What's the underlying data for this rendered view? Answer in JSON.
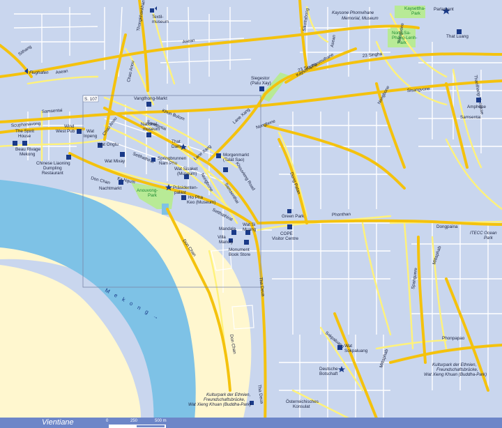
{
  "colors": {
    "land": "#c9d6ee",
    "water": "#7ec2e6",
    "sand": "#fff7cf",
    "park": "#b8ea96",
    "major_road": "#f4c20d",
    "minor_road": "#fff27a",
    "street": "#ffffff",
    "bar": "#6d86c8"
  },
  "footer": {
    "city": "Vientiane",
    "scale_0": "0",
    "scale_250": "250",
    "scale_500": "500 m"
  },
  "inset_label": "S. 107",
  "river_label": "M e k o n g →",
  "roads": {
    "samsentai_w": "Samsentai",
    "samsentai_c": "Samsentai",
    "samsentai_e": "Samsentai",
    "souphanavong": "Souphanavong",
    "asean_n": "Asean",
    "asean_w": "Asean",
    "sithang": "Sithang",
    "chao_anou_n": "Chao Anou",
    "chao_anou_s": "Chao Anou",
    "thongkhankham": "Thongkhankham",
    "khun_bulom": "Khun Bulom",
    "lane_xang": "Lane Xang",
    "lane_xang_s": "Lane Xang",
    "setthathirat": "Setthathirat",
    "setthathirat_s": "Setthathirat",
    "fa_ngum": "Fa Ngum",
    "don_chan_w": "Don Chan",
    "don_chan_c": "Don Chan",
    "don_chan_s": "Don Chan",
    "nongbone": "Nongbone",
    "nongbone_s": "Nongbone",
    "khouvieng": "Khouvieng Road",
    "dong_palan": "Dong Palan",
    "phonthan": "Phonthan",
    "dongpaina": "Dongpaina",
    "sisangvone": "Sisangvone",
    "kaysone": "Kaysone Phomvihane",
    "ring23": "23 Singha",
    "singha23": "23 Singha",
    "nongbone_ne": "Nongbone",
    "thatluang": "Thanthang-Hongkae",
    "sikottabong": "Sikottabong",
    "asean_e": "Asean",
    "nongbone_n": "Nongbone",
    "tha_deua": "Tha Deua",
    "tha_deua_s": "Tha Deua",
    "sokpaluang": "Sokpaluang",
    "phonpapao": "Phonpapao",
    "mittaphab": "Mittaphab",
    "mittaphab_s": "Mittaphab",
    "spanguere": "Spanguere",
    "samsenthai_khou": "Samsenthai"
  },
  "places": {
    "flughafen": "Flughafen",
    "textil1": "Textil-",
    "textil2": "museum",
    "kaysone_mem1": "Kaysone Phomvihane",
    "kaysone_mem2": "Memorial, Museum",
    "kaysettha1": "Kaysettha-",
    "kaysettha2": "Park",
    "parlament": "Parlament",
    "nongsa1": "Nong-Sa-",
    "nongsa2": "Phang-Lenh-",
    "nongsa3": "Park",
    "that_luang": "That Luang",
    "siegestor1": "Siegestor",
    "siegestor2": "(Patu Xay)",
    "amphone": "Amphone",
    "vangthong": "Vangthong-Markt",
    "national1": "National-",
    "national2": "museum",
    "spirit1": "The Spirit",
    "spirit2": "House",
    "beau1": "Beau Rivage",
    "beau2": "Mekong",
    "wind1": "Wind",
    "wind2": "West Pub",
    "watinpeng1": "Wat",
    "watinpeng2": "Inpeng",
    "ongtu": "Wat Ongtu",
    "mixay": "Wat Mixay",
    "thatdam1": "That",
    "thatdam2": "Dam",
    "springbrunnen1": "Springbrunnen",
    "springbrunnen2": "Nam Phu",
    "watsisaket1": "Wat Sisaket",
    "watsisaket2": "(Museum)",
    "morgenmarkt1": "Morgenmarkt",
    "morgenmarkt2": "(Talat Sao)",
    "chinese1": "Chinese Liaoning",
    "chinese2": "Dumpling",
    "chinese3": "Restaurant",
    "nachtmarkt": "Nachtmarkt",
    "praesident1": "Präsidenten-",
    "praesident2": "palast",
    "anouvong1": "Anouvong-",
    "anouvong2": "Park",
    "hophakeo1": "Ho Pha",
    "hophakeo2": "Keo (Museum)",
    "greenpark": "Green Park",
    "cope1": "COPE",
    "cope2": "Visitor Centre",
    "mandala": "Mandala",
    "villa1": "Villa",
    "villa2": "Manoly",
    "watsimuang1": "Wat Si",
    "watsimuang2": "Muang",
    "monument1": "Monument",
    "monument2": "Book Store",
    "itecc1": "ITECC Ocean",
    "itecc2": "Park",
    "watsok1": "Wat",
    "watsok2": "Sokpaluang",
    "botschaft1": "Deutsche",
    "botschaft2": "Botschaft",
    "kultur_e1": "Kulturpark der Ethnien,",
    "kultur_e2": "Freundschaftsbrücke,",
    "kultur_e3": "Wat Xieng Khuan (Buddha-Park)",
    "kultur_s1": "Kulturpark der Ethnien,",
    "kultur_s2": "Freundschaftsbrücke,",
    "kultur_s3": "Wat Xieng Khuan (Buddha-Park)",
    "oester1": "Österreichisches",
    "oester2": "Konsulat"
  }
}
